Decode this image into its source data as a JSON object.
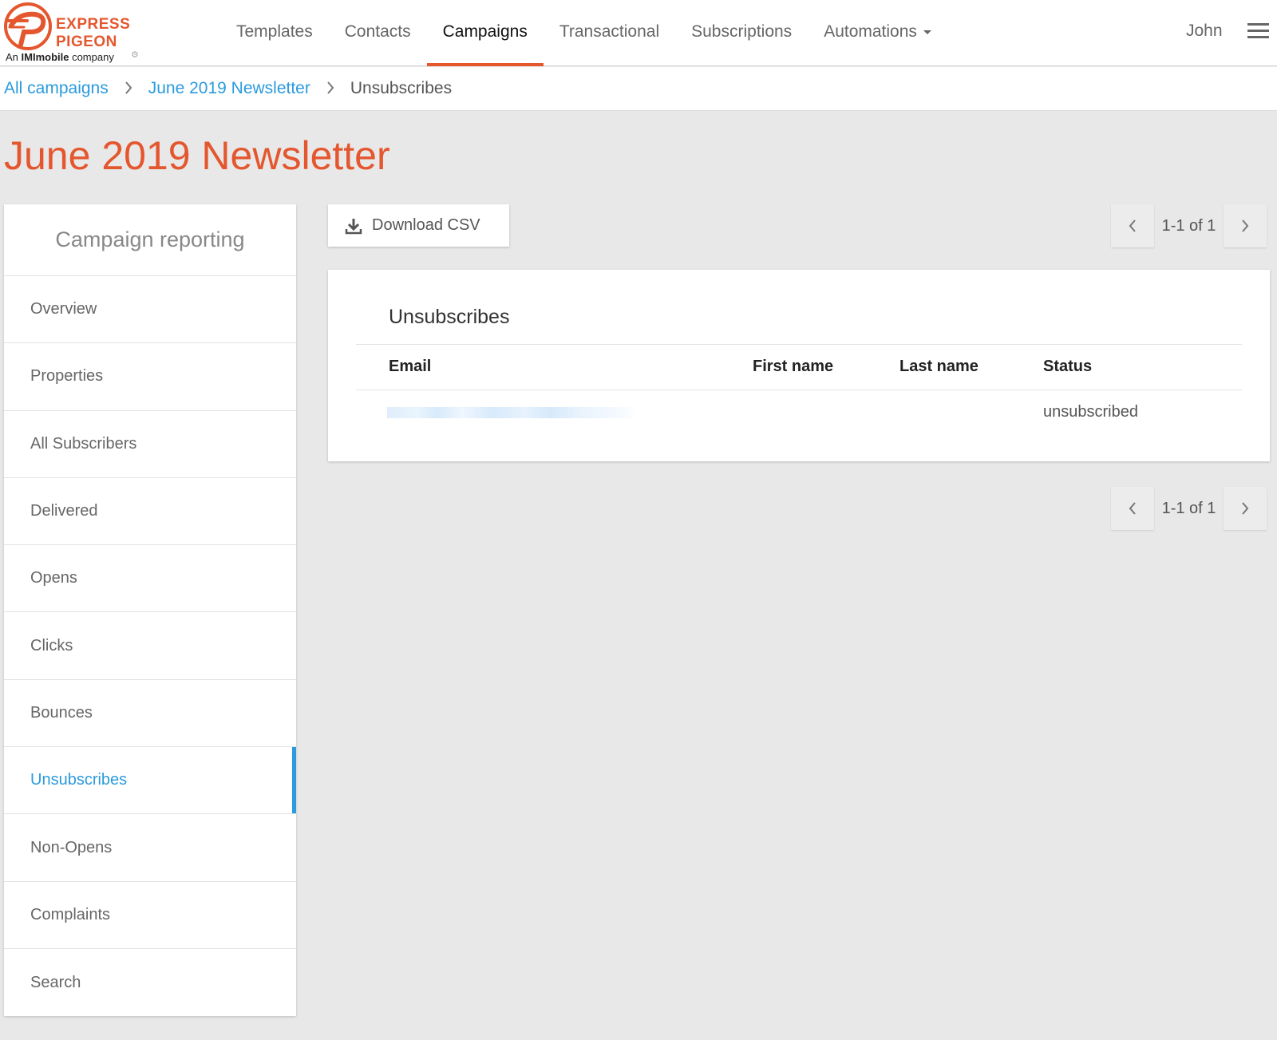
{
  "brand": {
    "line1": "EXPRESS",
    "line2": "PIGEON",
    "tagline_prefix": "An ",
    "tagline_bold": "IMImobile",
    "tagline_suffix": " company",
    "accent_color": "#e4572e"
  },
  "nav": {
    "items": [
      {
        "label": "Templates"
      },
      {
        "label": "Contacts"
      },
      {
        "label": "Campaigns",
        "active": true
      },
      {
        "label": "Transactional"
      },
      {
        "label": "Subscriptions"
      },
      {
        "label": "Automations",
        "has_dropdown": true
      }
    ],
    "user": "John",
    "menu_icon": "hamburger-icon"
  },
  "breadcrumb": {
    "items": [
      {
        "label": "All campaigns"
      },
      {
        "label": "June 2019 Newsletter"
      },
      {
        "label": "Unsubscribes"
      }
    ]
  },
  "page": {
    "title": "June 2019 Newsletter"
  },
  "sidebar": {
    "header": "Campaign reporting",
    "active_color": "#2b9bdd",
    "items": [
      {
        "label": "Overview"
      },
      {
        "label": "Properties"
      },
      {
        "label": "All Subscribers"
      },
      {
        "label": "Delivered"
      },
      {
        "label": "Opens"
      },
      {
        "label": "Clicks"
      },
      {
        "label": "Bounces"
      },
      {
        "label": "Unsubscribes",
        "active": true
      },
      {
        "label": "Non-Opens"
      },
      {
        "label": "Complaints"
      },
      {
        "label": "Search"
      }
    ]
  },
  "toolbar": {
    "download_label": "Download CSV",
    "download_icon": "download-icon"
  },
  "pagination": {
    "range": "1-1 of 1"
  },
  "table": {
    "title": "Unsubscribes",
    "columns": [
      "Email",
      "First name",
      "Last name",
      "Status"
    ],
    "rows": [
      {
        "email": "",
        "first_name": "",
        "last_name": "",
        "status": "unsubscribed"
      }
    ]
  }
}
